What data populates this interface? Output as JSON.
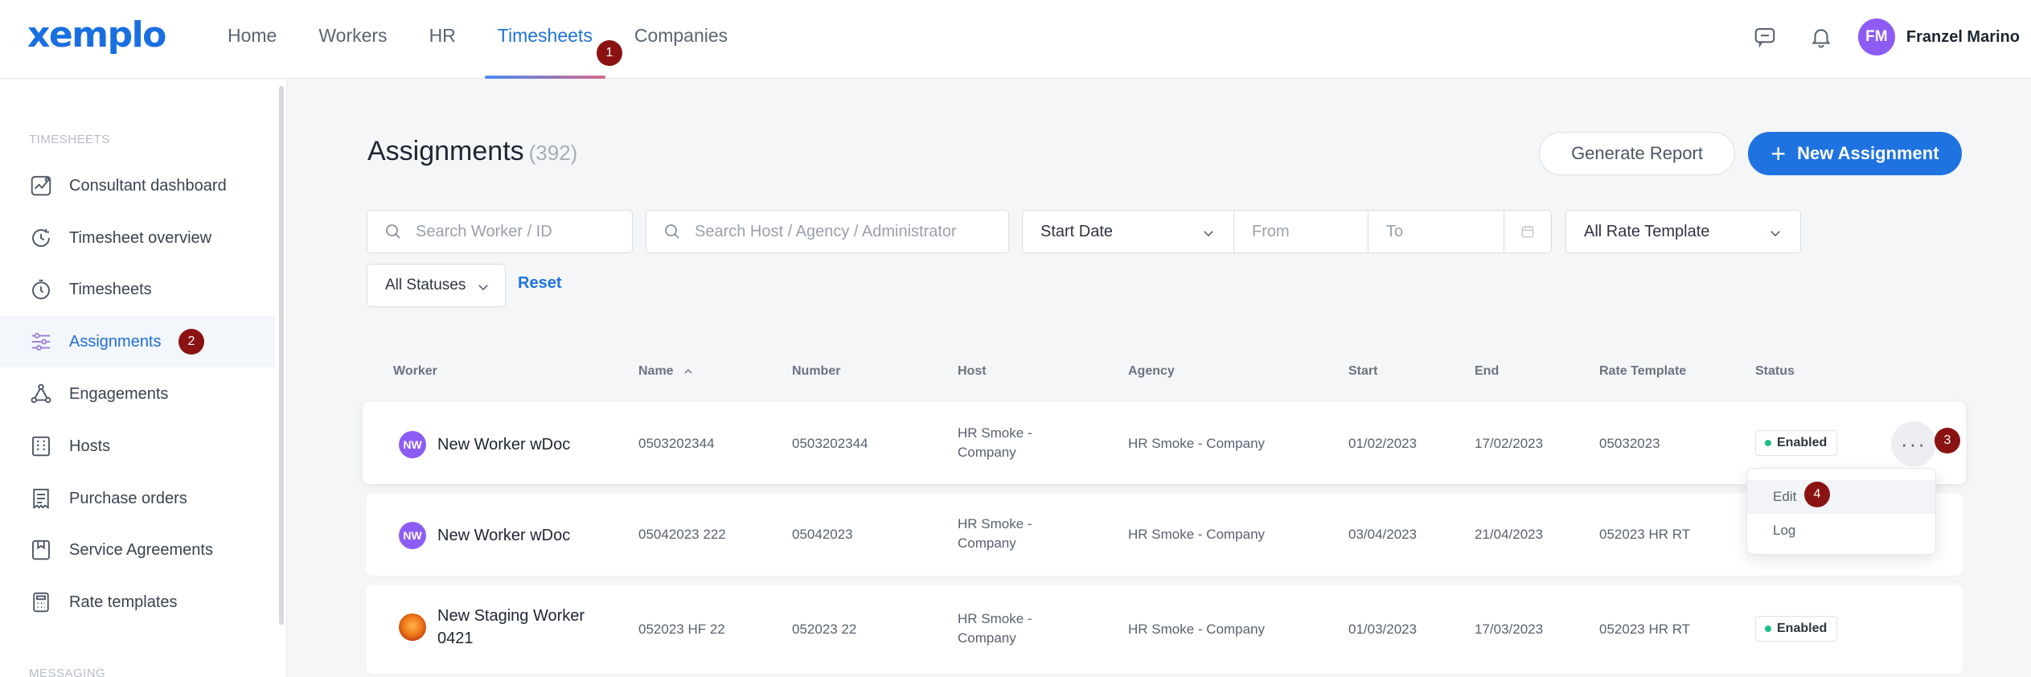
{
  "app": {
    "logo": "xemplo"
  },
  "nav": {
    "items": [
      {
        "label": "Home"
      },
      {
        "label": "Workers"
      },
      {
        "label": "HR"
      },
      {
        "label": "Timesheets",
        "active": true
      },
      {
        "label": "Companies"
      }
    ]
  },
  "user": {
    "initials": "FM",
    "name": "Franzel Marino"
  },
  "annotations": {
    "a1": "1",
    "a2": "2",
    "a3": "3",
    "a4": "4"
  },
  "sidebar": {
    "section1": "TIMESHEETS",
    "section2": "MESSAGING",
    "items": [
      {
        "label": "Consultant dashboard",
        "icon": "chart-line-icon"
      },
      {
        "label": "Timesheet overview",
        "icon": "clock-refresh-icon"
      },
      {
        "label": "Timesheets",
        "icon": "stopwatch-icon"
      },
      {
        "label": "Assignments",
        "icon": "sliders-icon",
        "active": true
      },
      {
        "label": "Engagements",
        "icon": "network-icon"
      },
      {
        "label": "Hosts",
        "icon": "building-icon"
      },
      {
        "label": "Purchase orders",
        "icon": "receipt-icon"
      },
      {
        "label": "Service Agreements",
        "icon": "bookmark-doc-icon"
      },
      {
        "label": "Rate templates",
        "icon": "calculator-icon"
      }
    ]
  },
  "page": {
    "title": "Assignments",
    "count": "(392)",
    "generate_report": "Generate Report",
    "new_assignment": "New Assignment"
  },
  "filters": {
    "search_worker_placeholder": "Search Worker / ID",
    "search_host_placeholder": "Search Host / Agency / Administrator",
    "date_type": "Start Date",
    "from_placeholder": "From",
    "to_placeholder": "To",
    "rate_template": "All Rate Template",
    "status": "All Statuses",
    "reset": "Reset"
  },
  "table": {
    "headers": {
      "worker": "Worker",
      "name": "Name",
      "number": "Number",
      "host": "Host",
      "agency": "Agency",
      "start": "Start",
      "end": "End",
      "rate_template": "Rate Template",
      "status": "Status"
    },
    "rows": [
      {
        "avatar": "NW",
        "worker": "New Worker wDoc",
        "name": "0503202344",
        "number": "0503202344",
        "host": "HR Smoke - Company",
        "agency": "HR Smoke - Company",
        "start": "01/02/2023",
        "end": "17/02/2023",
        "rate_template": "05032023",
        "status": "Enabled"
      },
      {
        "avatar": "NW",
        "worker": "New Worker wDoc",
        "name": "05042023 222",
        "number": "05042023",
        "host": "HR Smoke - Company",
        "agency": "HR Smoke - Company",
        "start": "03/04/2023",
        "end": "21/04/2023",
        "rate_template": "052023 HR RT",
        "status": ""
      },
      {
        "avatar": "",
        "worker": "New Staging Worker 0421",
        "name": "052023 HF 22",
        "number": "052023 22",
        "host": "HR Smoke - Company",
        "agency": "HR Smoke - Company",
        "start": "01/03/2023",
        "end": "17/03/2023",
        "rate_template": "052023 HR RT",
        "status": "Enabled"
      }
    ]
  },
  "row_menu": {
    "edit": "Edit",
    "log": "Log"
  }
}
